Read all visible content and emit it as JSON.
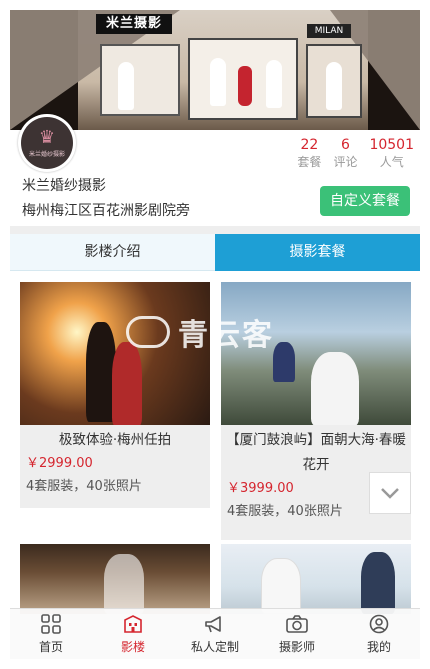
{
  "banner": {
    "store_sign": "米兰摄影",
    "side_sign": "MILAN"
  },
  "logo": {
    "text": "米兰婚纱摄影"
  },
  "stats": [
    {
      "value": "22",
      "label": "套餐"
    },
    {
      "value": "6",
      "label": "评论"
    },
    {
      "value": "10501",
      "label": "人气"
    }
  ],
  "shop": {
    "name": "米兰婚纱摄影",
    "address": "梅州梅江区百花洲影剧院旁",
    "custom_button": "自定义套餐"
  },
  "tabs": [
    {
      "label": "影楼介绍",
      "active": false
    },
    {
      "label": "摄影套餐",
      "active": true
    }
  ],
  "packages": [
    {
      "title": "极致体验·梅州任拍",
      "price": "￥2999.00",
      "meta": "4套服装，40张照片"
    },
    {
      "title": "【厦门鼓浪屿】面朝大海·春暖花开",
      "price": "￥3999.00",
      "meta": "4套服装，40张照片"
    }
  ],
  "watermark": "青云客",
  "bottom_nav": [
    {
      "label": "首页",
      "icon": "grid-icon",
      "active": false
    },
    {
      "label": "影楼",
      "icon": "building-icon",
      "active": true
    },
    {
      "label": "私人定制",
      "icon": "megaphone-icon",
      "active": false
    },
    {
      "label": "摄影师",
      "icon": "camera-icon",
      "active": false
    },
    {
      "label": "我的",
      "icon": "user-icon",
      "active": false
    }
  ],
  "colors": {
    "accent_blue": "#1e9fd5",
    "price_red": "#d5262f",
    "button_green": "#3bc178"
  }
}
